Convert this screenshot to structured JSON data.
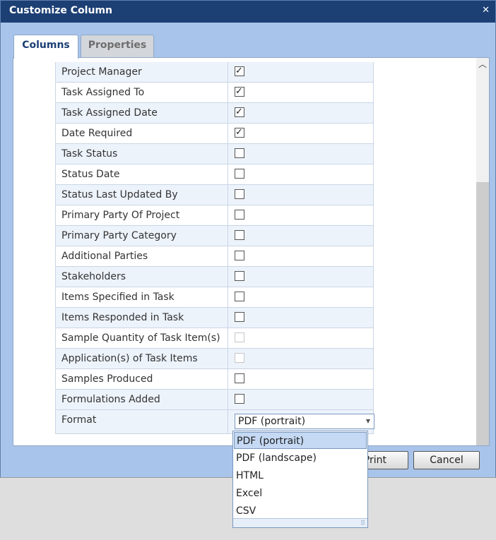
{
  "window": {
    "title": "Customize Column",
    "close_glyph": "✕"
  },
  "tabs": [
    {
      "label": "Columns",
      "active": true
    },
    {
      "label": "Properties",
      "active": false
    }
  ],
  "rows": [
    {
      "label": "Project Manager",
      "checked": true,
      "disabled": false
    },
    {
      "label": "Task Assigned To",
      "checked": true,
      "disabled": false
    },
    {
      "label": "Task Assigned Date",
      "checked": true,
      "disabled": false
    },
    {
      "label": "Date Required",
      "checked": true,
      "disabled": false
    },
    {
      "label": "Task Status",
      "checked": false,
      "disabled": false
    },
    {
      "label": "Status Date",
      "checked": false,
      "disabled": false
    },
    {
      "label": "Status Last Updated By",
      "checked": false,
      "disabled": false
    },
    {
      "label": "Primary Party Of Project",
      "checked": false,
      "disabled": false
    },
    {
      "label": "Primary Party Category",
      "checked": false,
      "disabled": false
    },
    {
      "label": "Additional Parties",
      "checked": false,
      "disabled": false
    },
    {
      "label": "Stakeholders",
      "checked": false,
      "disabled": false
    },
    {
      "label": "Items Specified in Task",
      "checked": false,
      "disabled": false
    },
    {
      "label": "Items Responded in Task",
      "checked": false,
      "disabled": false
    },
    {
      "label": "Sample Quantity of Task Item(s)",
      "checked": false,
      "disabled": true
    },
    {
      "label": "Application(s) of Task Items",
      "checked": false,
      "disabled": true
    },
    {
      "label": "Samples Produced",
      "checked": false,
      "disabled": false
    },
    {
      "label": "Formulations Added",
      "checked": false,
      "disabled": false
    }
  ],
  "format": {
    "label": "Format",
    "selected": "PDF (portrait)",
    "options": [
      "PDF (portrait)",
      "PDF (landscape)",
      "HTML",
      "Excel",
      "CSV"
    ]
  },
  "buttons": {
    "print_label": "Print",
    "print_visible_text": "rint",
    "cancel_label": "Cancel"
  },
  "icons": {
    "close": "close-icon",
    "scroll_up": "chevron-up-icon",
    "dropdown": "chevron-down-icon",
    "resize": "resize-grip-icon"
  },
  "colors": {
    "titlebar": "#1c3f74",
    "dialog_body": "#a9c4ea",
    "row_alt": "#edf3fb",
    "selected_option": "#c5d9f4"
  }
}
